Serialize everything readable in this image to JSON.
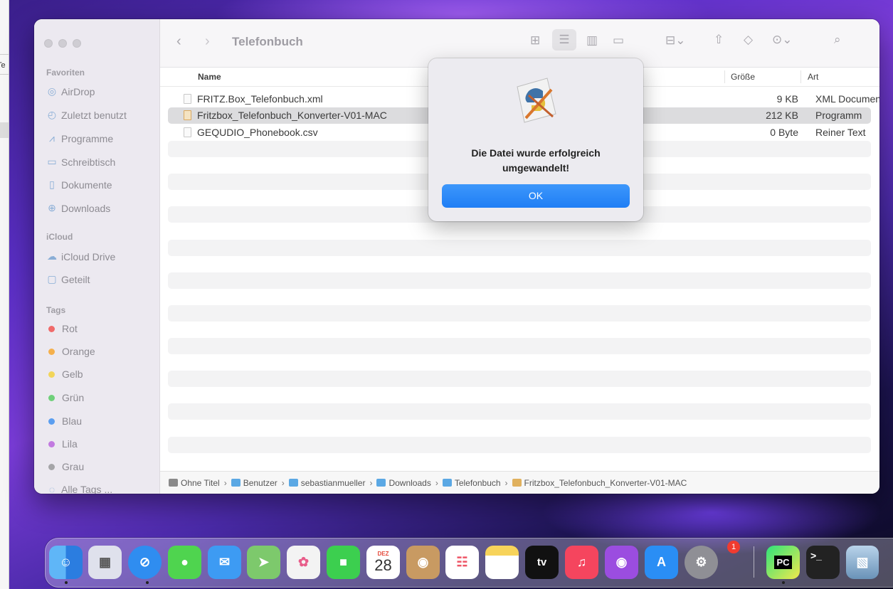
{
  "background_window": {
    "fragment": "Te"
  },
  "finder": {
    "title": "Telefonbuch",
    "sidebar": {
      "favorites_heading": "Favoriten",
      "favorites": [
        {
          "label": "AirDrop",
          "icon": "airdrop-icon"
        },
        {
          "label": "Zuletzt benutzt",
          "icon": "clock-icon"
        },
        {
          "label": "Programme",
          "icon": "applications-icon"
        },
        {
          "label": "Schreibtisch",
          "icon": "desktop-icon"
        },
        {
          "label": "Dokumente",
          "icon": "document-icon"
        },
        {
          "label": "Downloads",
          "icon": "download-icon"
        }
      ],
      "icloud_heading": "iCloud",
      "icloud": [
        {
          "label": "iCloud Drive",
          "icon": "cloud-icon"
        },
        {
          "label": "Geteilt",
          "icon": "shared-folder-icon"
        }
      ],
      "tags_heading": "Tags",
      "tags": [
        {
          "label": "Rot",
          "color": "#f06a6a"
        },
        {
          "label": "Orange",
          "color": "#f5b04c"
        },
        {
          "label": "Gelb",
          "color": "#f2d55a"
        },
        {
          "label": "Grün",
          "color": "#6fd07a"
        },
        {
          "label": "Blau",
          "color": "#5b9ef0"
        },
        {
          "label": "Lila",
          "color": "#c27ae0"
        },
        {
          "label": "Grau",
          "color": "#a5a5a8"
        },
        {
          "label": "Alle Tags ...",
          "color": "none"
        }
      ]
    },
    "columns": {
      "name": "Name",
      "size": "Größe",
      "kind": "Art"
    },
    "files": [
      {
        "name": "FRITZ.Box_Telefonbuch.xml",
        "size": "9 KB",
        "kind": "XML Document",
        "icon": "xml-file-icon"
      },
      {
        "name": "Fritzbox_Telefonbuch_Konverter-V01-MAC",
        "size": "212 KB",
        "kind": "Programm",
        "icon": "python-app-icon"
      },
      {
        "name": "GEQUDIO_Phonebook.csv",
        "size": "0 Byte",
        "kind": "Reiner Text",
        "icon": "text-file-icon"
      }
    ],
    "pathbar": [
      {
        "label": "Ohne Titel",
        "icon": "disk-icon"
      },
      {
        "label": "Benutzer",
        "icon": "folder-icon"
      },
      {
        "label": "sebastianmueller",
        "icon": "home-folder-icon"
      },
      {
        "label": "Downloads",
        "icon": "downloads-folder-icon"
      },
      {
        "label": "Telefonbuch",
        "icon": "folder-icon"
      },
      {
        "label": "Fritzbox_Telefonbuch_Konverter-V01-MAC",
        "icon": "python-app-icon"
      }
    ]
  },
  "alert": {
    "message_line1": "Die Datei wurde erfolgreich",
    "message_line2": "umgewandelt!",
    "ok_label": "OK",
    "icon": "python-launcher-icon"
  },
  "dock": {
    "calendar_month": "DEZ",
    "calendar_day": "28",
    "tv_label": "tv",
    "pycharm_label": "PC",
    "terminal_label": ">_",
    "settings_badge": "1",
    "apps": [
      "Finder",
      "Launchpad",
      "Safari",
      "Messages",
      "Mail",
      "Maps",
      "Photos",
      "FaceTime",
      "Calendar",
      "Contacts",
      "Reminders",
      "Notes",
      "TV",
      "Music",
      "Podcasts",
      "App Store",
      "System Preferences",
      "PyCharm",
      "Terminal",
      "Preview"
    ]
  }
}
